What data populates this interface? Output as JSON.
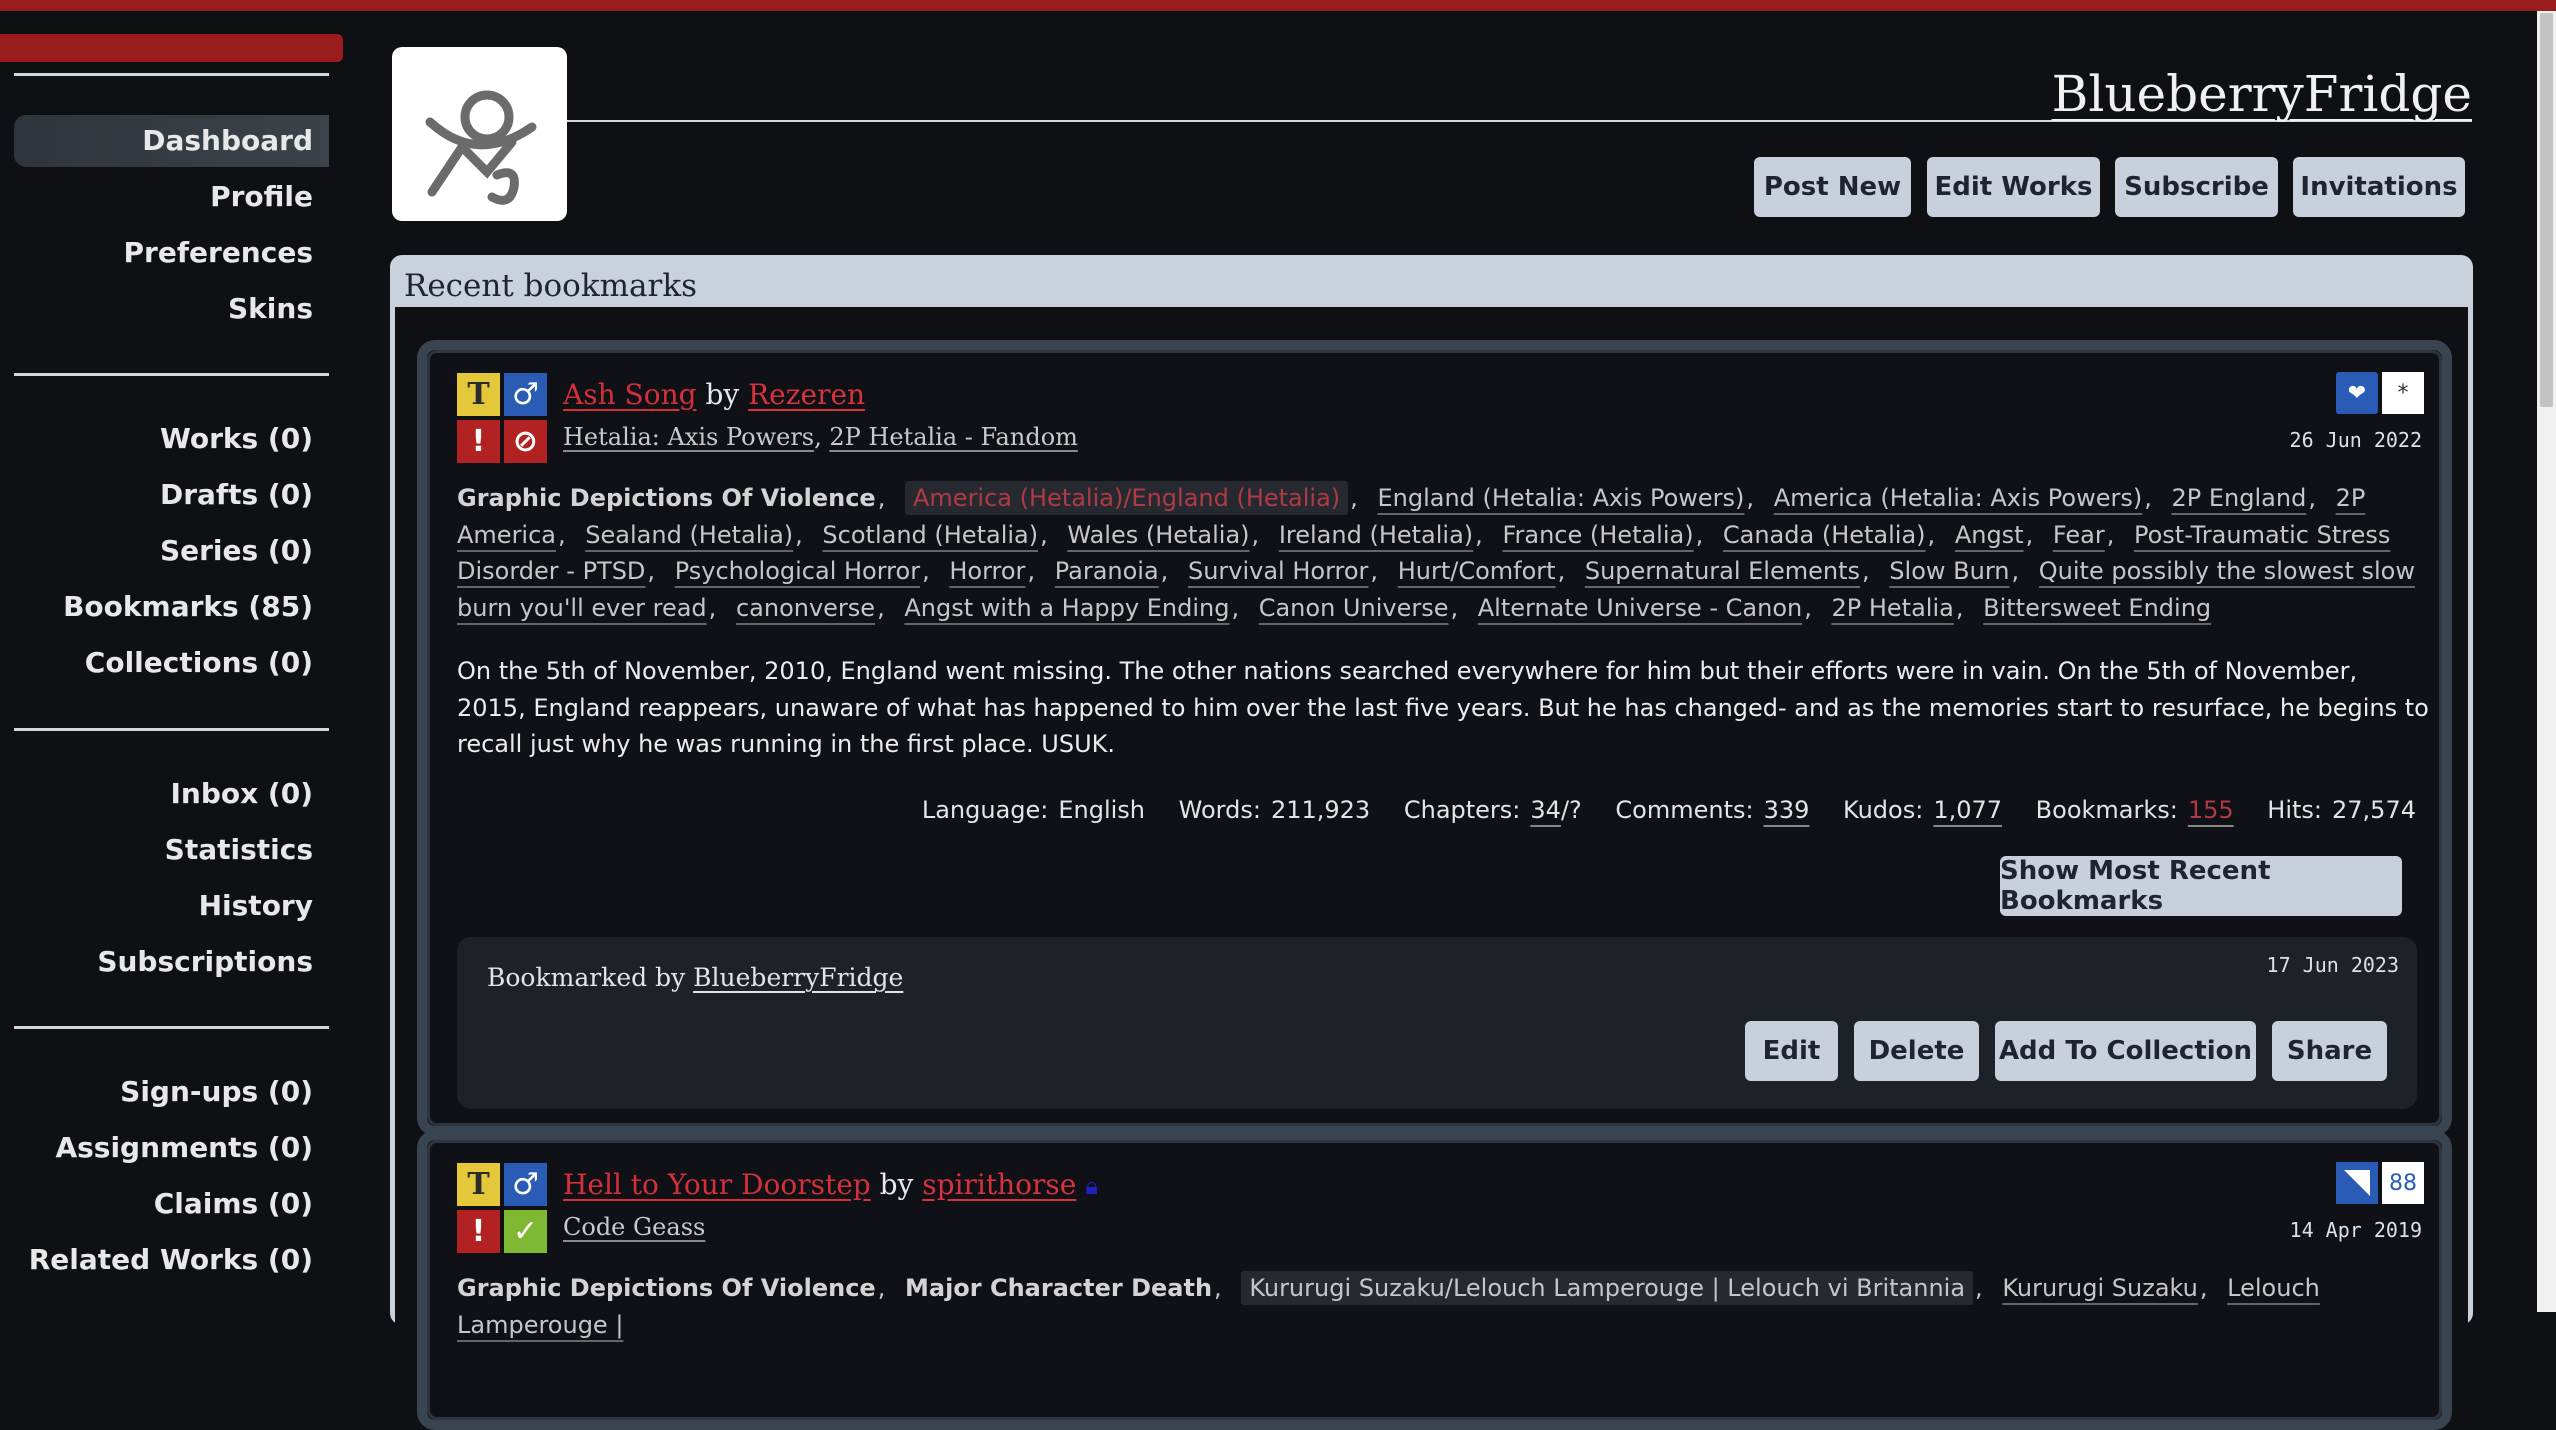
{
  "sidebar": {
    "groups": [
      [
        "Dashboard",
        "Profile",
        "Preferences",
        "Skins"
      ],
      [
        "Works (0)",
        "Drafts (0)",
        "Series (0)",
        "Bookmarks (85)",
        "Collections (0)"
      ],
      [
        "Inbox (0)",
        "Statistics",
        "History",
        "Subscriptions"
      ],
      [
        "Sign-ups (0)",
        "Assignments (0)",
        "Claims (0)",
        "Related Works (0)"
      ]
    ],
    "active": "Dashboard"
  },
  "header": {
    "username": "BlueberryFridge",
    "buttons": [
      "Post New",
      "Edit Works",
      "Subscribe",
      "Invitations"
    ]
  },
  "panel": {
    "title": "Recent bookmarks"
  },
  "bookmarks": [
    {
      "title": "Ash Song",
      "by": "by",
      "author": "Rezeren",
      "fandoms": [
        "Hetalia: Axis Powers",
        "2P Hetalia - Fandom"
      ],
      "date": "26 Jun 2022",
      "warnings": [
        "Graphic Depictions Of Violence"
      ],
      "relationships": [
        "America (Hetalia)/England (Hetalia)"
      ],
      "tags": [
        "England (Hetalia: Axis Powers)",
        "America (Hetalia: Axis Powers)",
        "2P England",
        "2P America",
        "Sealand (Hetalia)",
        "Scotland (Hetalia)",
        "Wales (Hetalia)",
        "Ireland (Hetalia)",
        "France (Hetalia)",
        "Canada (Hetalia)",
        "Angst",
        "Fear",
        "Post-Traumatic Stress Disorder - PTSD",
        "Psychological Horror",
        "Horror",
        "Paranoia",
        "Survival Horror",
        "Hurt/Comfort",
        "Supernatural Elements",
        "Slow Burn",
        "Quite possibly the slowest slow burn you'll ever read",
        "canonverse",
        "Angst with a Happy Ending",
        "Canon Universe",
        "Alternate Universe - Canon",
        "2P Hetalia",
        "Bittersweet Ending"
      ],
      "summary": "On the 5th of November, 2010, England went missing. The other nations searched everywhere for him but their efforts were in vain. On the 5th of November, 2015, England reappears, unaware of what has happened to him over the last five years. But he has changed- and as the memories start to resurface, he begins to recall just why he was running in the first place. USUK.",
      "stats": {
        "language_label": "Language:",
        "language": "English",
        "words_label": "Words:",
        "words": "211,923",
        "chapters_label": "Chapters:",
        "chapters": "34",
        "chapters_total": "/?",
        "comments_label": "Comments:",
        "comments": "339",
        "kudos_label": "Kudos:",
        "kudos": "1,077",
        "bookmarks_label": "Bookmarks:",
        "bookmarks": "155",
        "hits_label": "Hits:",
        "hits": "27,574"
      },
      "show_recent_label": "Show Most Recent Bookmarks",
      "bookmarked_by_label": "Bookmarked by",
      "bookmarked_by": "BlueberryFridge",
      "bookmark_date": "17 Jun 2023",
      "actions": [
        "Edit",
        "Delete",
        "Add To Collection",
        "Share"
      ]
    },
    {
      "title": "Hell to Your Doorstep",
      "by": "by",
      "author": "spirithorse",
      "fandoms": [
        "Code Geass"
      ],
      "date": "14 Apr 2019",
      "series_count": "88",
      "warnings": [
        "Graphic Depictions Of Violence",
        "Major Character Death"
      ],
      "relationships": [
        "Kururugi Suzaku/Lelouch Lamperouge | Lelouch vi Britannia"
      ],
      "tags": [
        "Kururugi Suzaku",
        "Lelouch Lamperouge |"
      ]
    }
  ],
  "colors": {
    "accent": "#9b1c1c",
    "link": "#d5303a",
    "button": "#c8d0db",
    "panel": "#c9d1dc"
  }
}
